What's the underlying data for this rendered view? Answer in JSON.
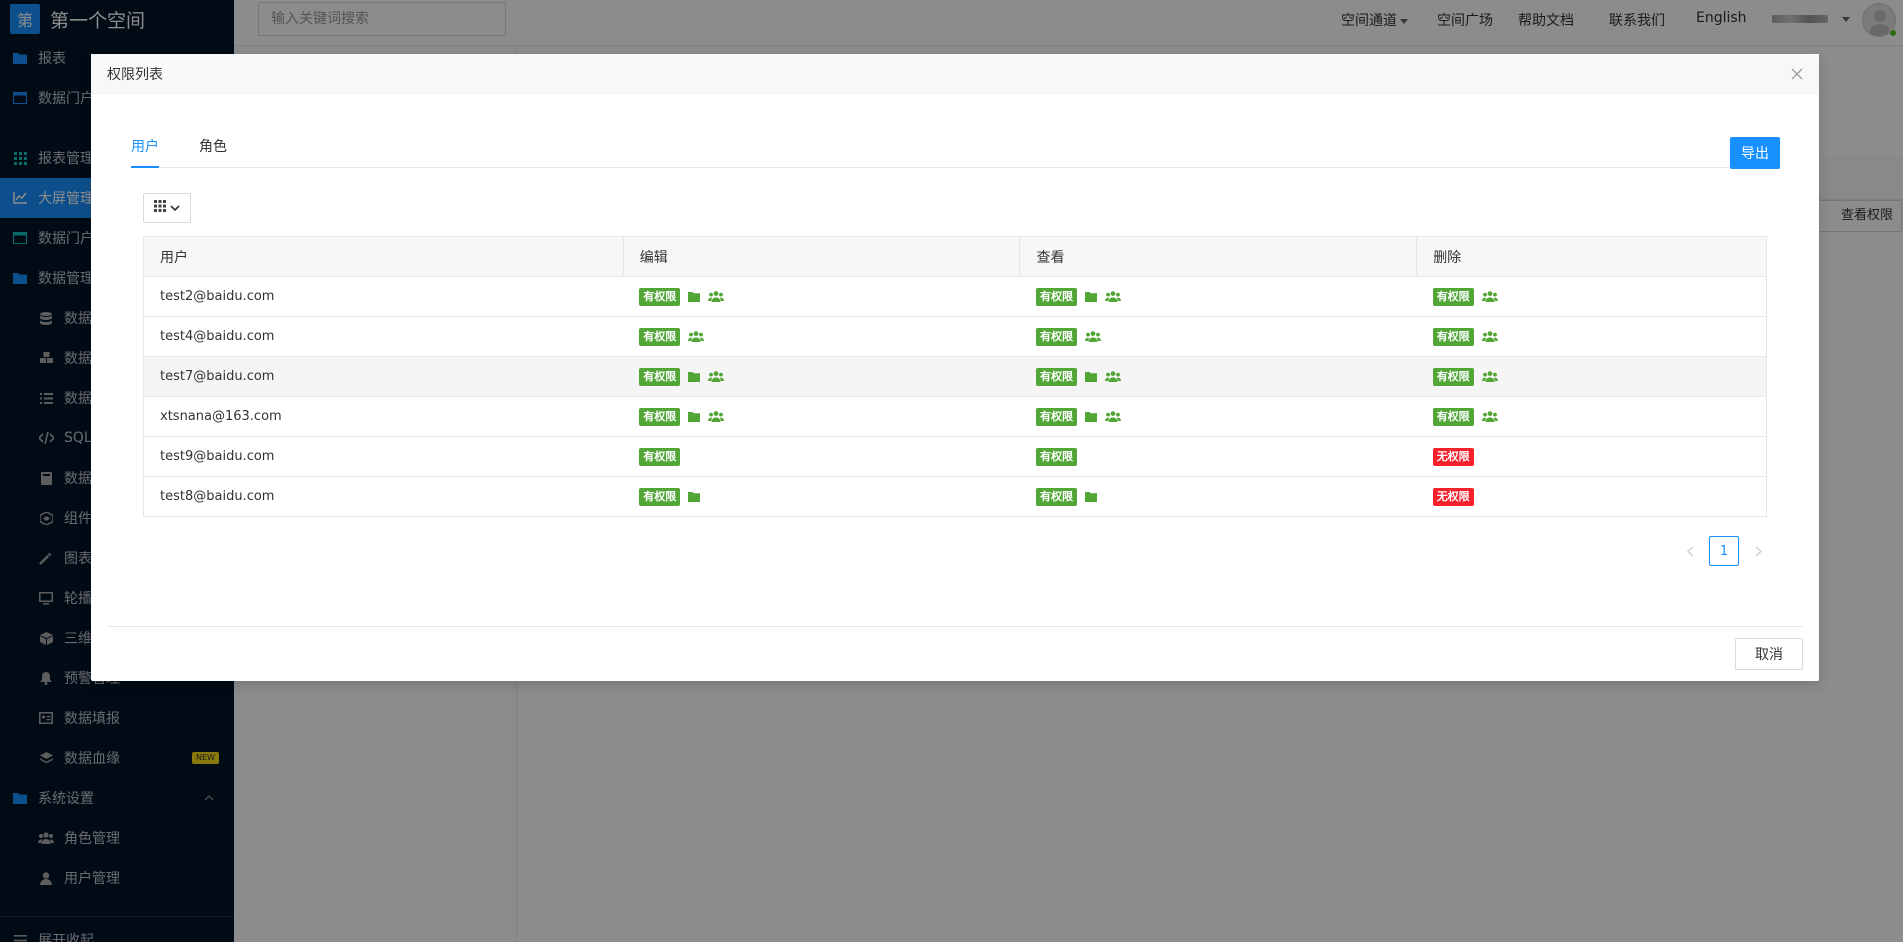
{
  "brand": {
    "logo_char": "第",
    "name": "第一个空间"
  },
  "sidebar": {
    "items": [
      {
        "label": "报表",
        "icon": "folder-icon"
      },
      {
        "label": "数据门户",
        "icon": "window-icon"
      },
      {
        "label": "报表管理",
        "icon": "grid-icon"
      },
      {
        "label": "大屏管理",
        "icon": "chart-line-icon"
      },
      {
        "label": "数据门户",
        "icon": "window-icon"
      },
      {
        "label": "数据管理",
        "icon": "folder-icon"
      },
      {
        "label": "数据",
        "icon": "database-icon"
      },
      {
        "label": "数据",
        "icon": "cubes-icon"
      },
      {
        "label": "数据",
        "icon": "list-icon"
      },
      {
        "label": "SQL",
        "icon": "code-icon"
      },
      {
        "label": "数据",
        "icon": "book-icon"
      },
      {
        "label": "组件",
        "icon": "component-icon"
      },
      {
        "label": "图表",
        "icon": "magic-icon"
      },
      {
        "label": "轮播",
        "icon": "monitor-icon"
      },
      {
        "label": "三维",
        "icon": "cube-icon"
      },
      {
        "label": "预警管理",
        "icon": "bell-icon"
      },
      {
        "label": "数据填报",
        "icon": "form-icon"
      },
      {
        "label": "数据血缘",
        "icon": "layers-icon",
        "badge": "NEW"
      },
      {
        "label": "系统设置",
        "icon": "folder-icon"
      },
      {
        "label": "角色管理",
        "icon": "users-icon"
      },
      {
        "label": "用户管理",
        "icon": "user-icon"
      },
      {
        "label": "展开收起",
        "icon": "menu-icon"
      }
    ]
  },
  "header": {
    "search_placeholder": "输入关键词搜索",
    "nav": [
      "空间通道",
      "空间广场",
      "帮助文档",
      "联系我们",
      "English"
    ]
  },
  "background": {
    "action_button": "查看权限"
  },
  "modal": {
    "title": "权限列表",
    "tabs": [
      "用户",
      "角色"
    ],
    "export_label": "导出",
    "cancel_label": "取消",
    "columns": [
      "用户",
      "编辑",
      "查看",
      "删除"
    ],
    "rows": [
      {
        "user": "test2@baidu.com",
        "edit": {
          "tag": "有权限",
          "granted": true,
          "folder": true,
          "group": true
        },
        "view": {
          "tag": "有权限",
          "granted": true,
          "folder": true,
          "group": true
        },
        "del": {
          "tag": "有权限",
          "granted": true,
          "folder": false,
          "group": true
        }
      },
      {
        "user": "test4@baidu.com",
        "edit": {
          "tag": "有权限",
          "granted": true,
          "folder": false,
          "group": true
        },
        "view": {
          "tag": "有权限",
          "granted": true,
          "folder": false,
          "group": true
        },
        "del": {
          "tag": "有权限",
          "granted": true,
          "folder": false,
          "group": true
        }
      },
      {
        "user": "test7@baidu.com",
        "edit": {
          "tag": "有权限",
          "granted": true,
          "folder": true,
          "group": true
        },
        "view": {
          "tag": "有权限",
          "granted": true,
          "folder": true,
          "group": true
        },
        "del": {
          "tag": "有权限",
          "granted": true,
          "folder": false,
          "group": true
        }
      },
      {
        "user": "xtsnana@163.com",
        "edit": {
          "tag": "有权限",
          "granted": true,
          "folder": true,
          "group": true
        },
        "view": {
          "tag": "有权限",
          "granted": true,
          "folder": true,
          "group": true
        },
        "del": {
          "tag": "有权限",
          "granted": true,
          "folder": false,
          "group": true
        }
      },
      {
        "user": "test9@baidu.com",
        "edit": {
          "tag": "有权限",
          "granted": true,
          "folder": false,
          "group": false
        },
        "view": {
          "tag": "有权限",
          "granted": true,
          "folder": false,
          "group": false
        },
        "del": {
          "tag": "无权限",
          "granted": false,
          "folder": false,
          "group": false
        }
      },
      {
        "user": "test8@baidu.com",
        "edit": {
          "tag": "有权限",
          "granted": true,
          "folder": true,
          "group": false
        },
        "view": {
          "tag": "有权限",
          "granted": true,
          "folder": true,
          "group": false
        },
        "del": {
          "tag": "无权限",
          "granted": false,
          "folder": false,
          "group": false
        }
      }
    ],
    "pagination": {
      "current": "1"
    }
  },
  "colors": {
    "primary": "#1890ff",
    "granted": "#52a636",
    "denied": "#f5222d",
    "sidebar_bg": "#001529"
  }
}
